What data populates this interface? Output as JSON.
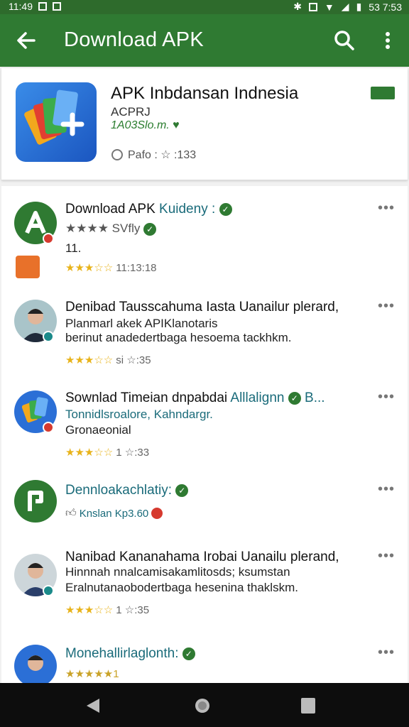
{
  "status_bar": {
    "left_text": "11:49",
    "right_text": "53 7:53"
  },
  "app_bar": {
    "title": "Download APK"
  },
  "app_card": {
    "title": "APK Inbdansan Indnesia",
    "developer": "ACPRJ",
    "meta": "1A03Slo.m.",
    "rating_text": "Pafo : ☆ :133"
  },
  "items": [
    {
      "title": "Download APK",
      "title_tail": "Kuideny :",
      "line2": "★★★★ SVfly",
      "line3": "11.",
      "rating": "11:13:18"
    },
    {
      "title": "Denibad Tausscahuma Iasta Uanailur plerard,",
      "line2": "Planmarl akek APIKlanotaris",
      "line3": "berinut anadedertbaga hesoema tackhkm.",
      "rating": "si ☆:35"
    },
    {
      "title": "Sownlad Timeian dnpabdai",
      "title_tail": "Alllalignn",
      "title_tail2": "B...",
      "line2": "Tonnidlsroalore, Kahndargr.",
      "line3": "Gronaeonial",
      "rating": "1 ☆:33"
    },
    {
      "title": "Dennloakachlatiy:",
      "line2": "Knslan Kp3.60",
      "rating": ""
    },
    {
      "title": "Nanibad Kananahama Irobai Uanailu plerand,",
      "line2": "Hinnnah nnalcamisakamlitosds; ksumstan",
      "line3": "Eralnutanaobodertbaga hesenina thaklskm.",
      "rating": "1 ☆:35"
    },
    {
      "title": "Monehallirlaglonth:",
      "rating": "★★★★★1"
    }
  ],
  "colors": {
    "appbar": "#2f7a32",
    "statusbar": "#2e6b2c",
    "star": "#e8b31a",
    "teal": "#1a6b7a"
  }
}
